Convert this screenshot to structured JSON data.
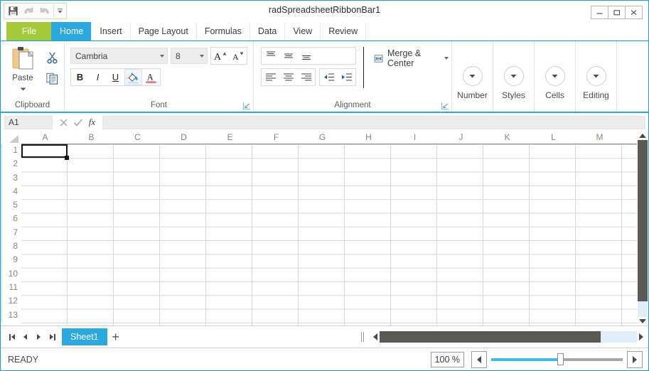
{
  "window": {
    "title": "radSpreadsheetRibbonBar1",
    "minimize": "–",
    "maximize": "□",
    "close": "✕"
  },
  "quick_access": {
    "save": "save-icon",
    "undo": "undo-icon",
    "redo": "redo-icon",
    "customize": "customize-caret-icon"
  },
  "tabs": [
    {
      "label": "File",
      "state": "file"
    },
    {
      "label": "Home",
      "state": "active"
    },
    {
      "label": "Insert",
      "state": "normal"
    },
    {
      "label": "Page Layout",
      "state": "normal"
    },
    {
      "label": "Formulas",
      "state": "normal"
    },
    {
      "label": "Data",
      "state": "normal"
    },
    {
      "label": "View",
      "state": "normal"
    },
    {
      "label": "Review",
      "state": "normal"
    }
  ],
  "ribbon": {
    "clipboard": {
      "title": "Clipboard",
      "paste_label": "Paste",
      "cut": "scissors-icon",
      "copy": "copy-icon"
    },
    "font": {
      "title": "Font",
      "font_name": "Cambria",
      "font_size": "8",
      "grow_font": "A",
      "shrink_font": "A",
      "bold": "B",
      "italic": "I",
      "underline": "U",
      "fill_color": "fill-color-icon",
      "font_color": "A"
    },
    "alignment": {
      "title": "Alignment",
      "merge_label": "Merge & Center"
    },
    "collapsed_groups": [
      {
        "label": "Number"
      },
      {
        "label": "Styles"
      },
      {
        "label": "Cells"
      },
      {
        "label": "Editing"
      }
    ]
  },
  "formula_bar": {
    "name_box": "A1",
    "cancel": "✕",
    "confirm": "✓",
    "function": "fx",
    "formula_value": ""
  },
  "grid": {
    "columns": [
      "A",
      "B",
      "C",
      "D",
      "E",
      "F",
      "G",
      "H",
      "I",
      "J",
      "K",
      "L",
      "M"
    ],
    "rows": [
      "1",
      "2",
      "3",
      "4",
      "5",
      "6",
      "7",
      "8",
      "9",
      "10",
      "11",
      "12",
      "13"
    ],
    "selected_cell": "A1"
  },
  "sheet_tabs": {
    "tabs": [
      {
        "label": "Sheet1",
        "active": true
      }
    ],
    "add_label": "+"
  },
  "status_bar": {
    "status": "READY",
    "zoom_value": "100 %"
  },
  "colors": {
    "accent": "#2aa9e0",
    "file_tab": "#a4ca39",
    "scroll_thumb": "#5a5a55",
    "scroll_track": "#ddeef8"
  }
}
